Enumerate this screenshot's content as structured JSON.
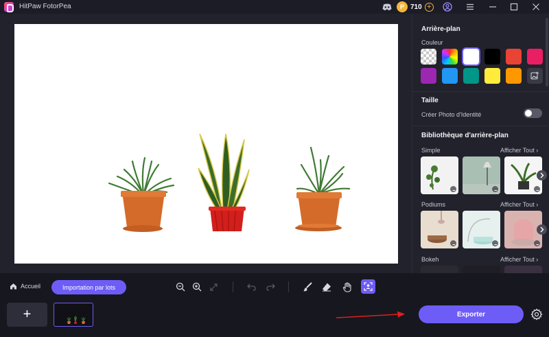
{
  "app": {
    "title": "HitPaw FotorPea",
    "credits": "710"
  },
  "panel": {
    "background_title": "Arrière-plan",
    "color_label": "Couleur",
    "swatches": [
      "transparent",
      "rainbow",
      "#ffffff",
      "#000000",
      "#e84335",
      "#e91e63",
      "#9c27b0",
      "#2196f3",
      "#009688",
      "#ffeb3b",
      "#ff9800",
      "add-image"
    ],
    "size_title": "Taille",
    "id_photo_label": "Créer Photo d'Identité",
    "id_photo_enabled": false,
    "library_title": "Bibliothèque d'arrière-plan",
    "categories": [
      {
        "name": "Simple",
        "see_all": "Afficher Tout"
      },
      {
        "name": "Podiums",
        "see_all": "Afficher Tout"
      },
      {
        "name": "Bokeh",
        "see_all": "Afficher Tout"
      }
    ]
  },
  "toolbar": {
    "home_label": "Accueil",
    "batch_label": "Importation par lots"
  },
  "strip": {
    "add_label": "+",
    "export_label": "Exporter"
  },
  "colors": {
    "accent": "#6e5cf6",
    "annotation_arrow": "#e0201e"
  }
}
